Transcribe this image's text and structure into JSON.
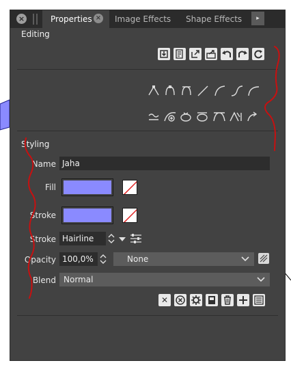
{
  "tabs": [
    {
      "label": "Properties",
      "active": true
    },
    {
      "label": "Image Effects",
      "active": false
    },
    {
      "label": "Shape Effects",
      "active": false
    }
  ],
  "sections": {
    "editing": "Editing",
    "styling": "Styling"
  },
  "editing_toolbar": [
    "import-icon",
    "list-icon",
    "external-link-icon",
    "share-icon",
    "undo-icon",
    "redo-icon",
    "refresh-icon"
  ],
  "path_tools": {
    "row1": [
      "node-cusp-icon",
      "node-smooth-icon",
      "node-symmetric-icon",
      "line-segment-icon",
      "curve-icon",
      "s-curve-icon",
      "arc-icon"
    ],
    "row2": [
      "wave-icon",
      "add-node-icon",
      "loop-icon",
      "loop-alt-icon",
      "node-split-icon",
      "node-join-icon",
      "flip-icon"
    ]
  },
  "styling": {
    "name_label": "Name",
    "name_value": "Jaha",
    "fill_label": "Fill",
    "fill_color": "#8a8aff",
    "stroke_label": "Stroke",
    "stroke_color": "#8a8aff",
    "stroke_style_label": "Stroke",
    "stroke_style_value": "Hairline",
    "opacity_label": "Opacity",
    "opacity_value": "100,0%",
    "opacity_mode": "None",
    "blend_label": "Blend",
    "blend_value": "Normal"
  },
  "bottom_toolbar": [
    "delete-icon",
    "remove-icon",
    "settings-icon",
    "save-icon",
    "trash-icon",
    "add-icon",
    "list-view-icon"
  ],
  "colors": {
    "panel": "#424242",
    "tabbar": "#2b2b2b",
    "annotation": "#c81010",
    "background_shape": "#8a8aff"
  }
}
